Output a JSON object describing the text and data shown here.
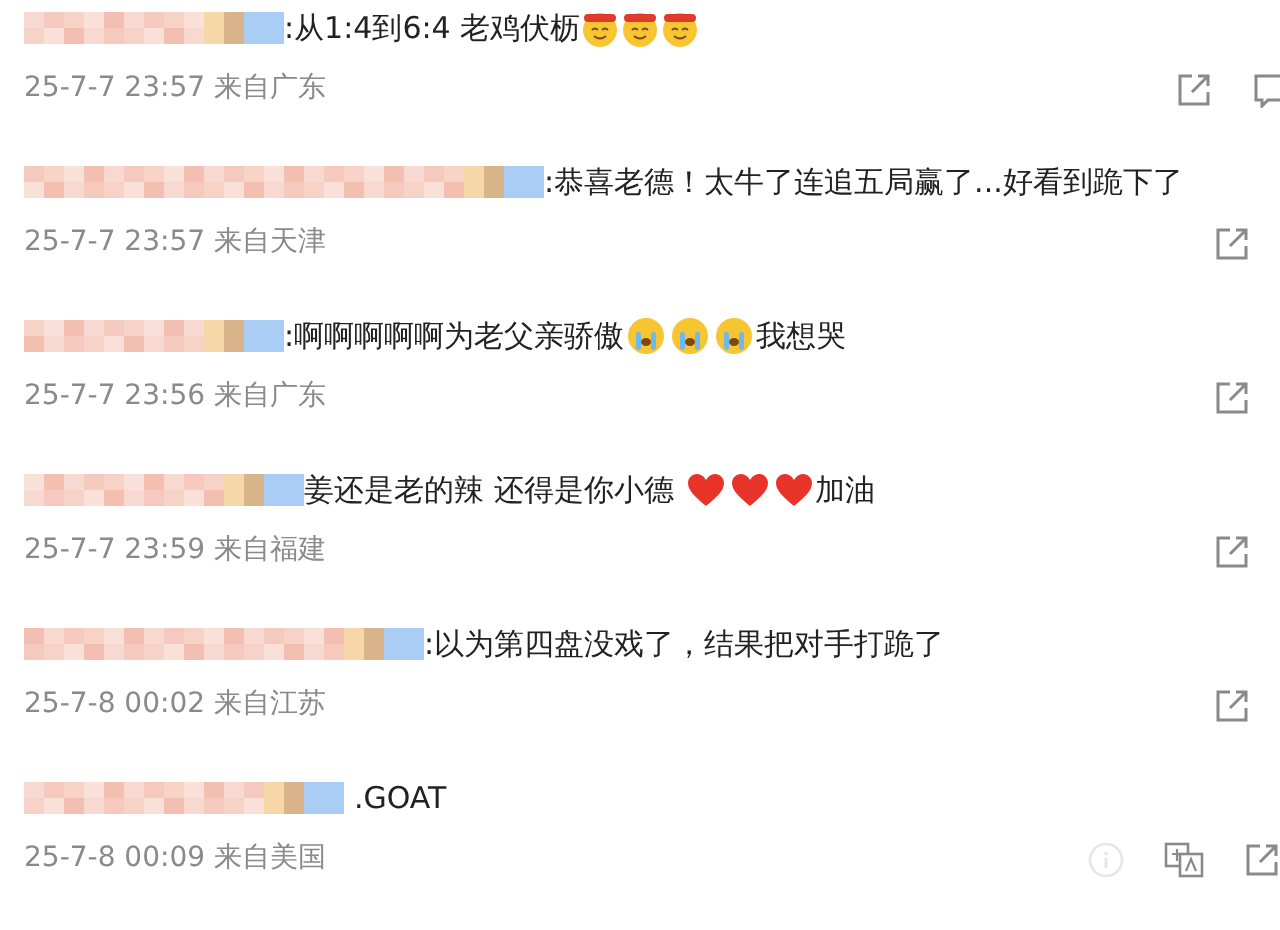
{
  "comments": [
    {
      "text": [
        {
          "kind": "text",
          "value": ":从1:4到6:4 老鸡伏枥"
        },
        {
          "kind": "headband-face"
        },
        {
          "kind": "headband-face"
        },
        {
          "kind": "headband-face"
        }
      ],
      "meta": "25-7-7 23:57 来自广东",
      "actions": [
        {
          "kind": "share"
        },
        {
          "kind": "comment"
        }
      ]
    },
    {
      "text": [
        {
          "kind": "text",
          "value": ":恭喜老德！太牛了连追五局赢了...好看到跪下了"
        }
      ],
      "meta": "25-7-7 23:57 来自天津",
      "actions": [
        {
          "kind": "share"
        }
      ]
    },
    {
      "text": [
        {
          "kind": "text",
          "value": ":啊啊啊啊啊为老父亲骄傲"
        },
        {
          "kind": "crying-face"
        },
        {
          "kind": "crying-face"
        },
        {
          "kind": "crying-face"
        },
        {
          "kind": "text",
          "value": "我想哭"
        }
      ],
      "meta": "25-7-7 23:56 来自广东",
      "actions": [
        {
          "kind": "share"
        }
      ]
    },
    {
      "text": [
        {
          "kind": "text",
          "value": "姜还是老的辣 还得是你小德 "
        },
        {
          "kind": "heart"
        },
        {
          "kind": "heart"
        },
        {
          "kind": "heart"
        },
        {
          "kind": "text",
          "value": "加油"
        }
      ],
      "meta": "25-7-7 23:59 来自福建",
      "actions": [
        {
          "kind": "share"
        }
      ]
    },
    {
      "text": [
        {
          "kind": "text",
          "value": ":以为第四盘没戏了，结果把对手打跪了"
        }
      ],
      "meta": "25-7-8 00:02 来自江苏",
      "actions": [
        {
          "kind": "share"
        }
      ]
    },
    {
      "text": [
        {
          "kind": "text",
          "value": ".GOAT"
        }
      ],
      "meta": "25-7-8 00:09 来自美国",
      "actions": [
        {
          "kind": "info"
        },
        {
          "kind": "translate"
        },
        {
          "kind": "share"
        }
      ]
    }
  ]
}
